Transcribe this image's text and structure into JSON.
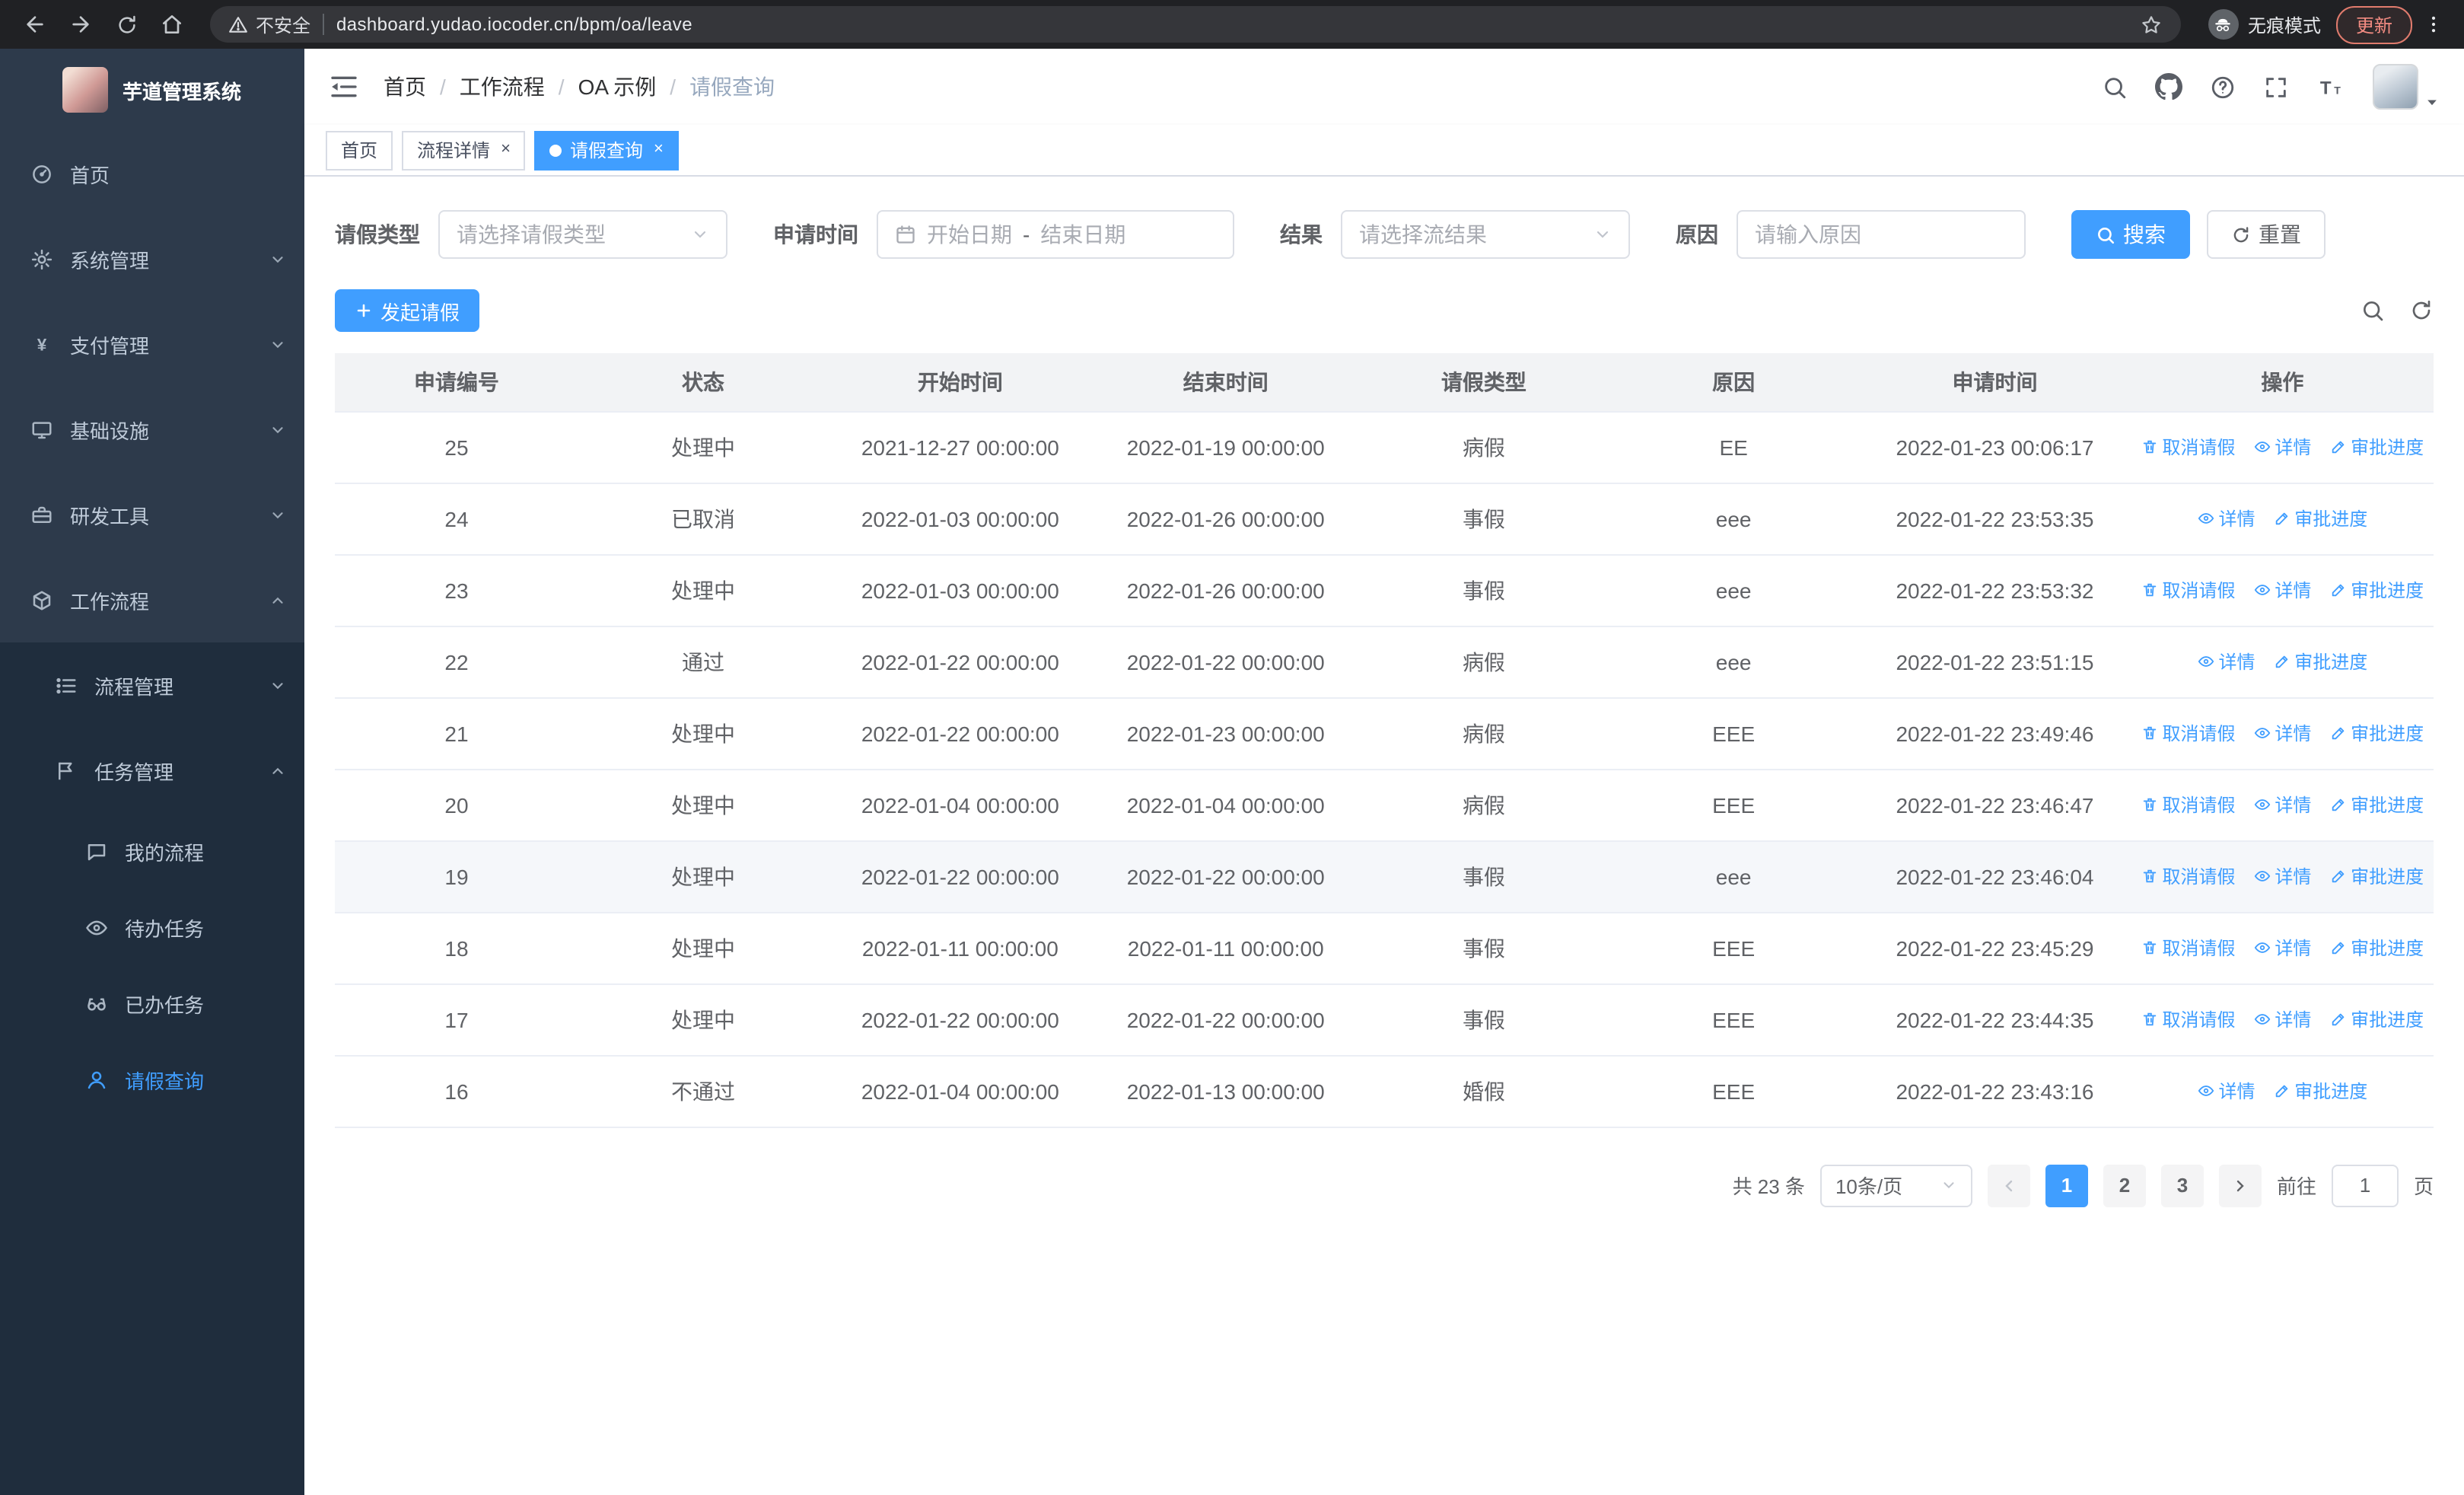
{
  "icons": {
    "close": "×"
  },
  "browser": {
    "security_label": "不安全",
    "url": "dashboard.yudao.iocoder.cn/bpm/oa/leave",
    "incognito_label": "无痕模式",
    "update_label": "更新"
  },
  "sidebar": {
    "title": "芋道管理系统",
    "items": [
      {
        "label": "首页",
        "icon": "dashboard"
      },
      {
        "label": "系统管理",
        "icon": "gear"
      },
      {
        "label": "支付管理",
        "icon": "yen"
      },
      {
        "label": "基础设施",
        "icon": "monitor"
      },
      {
        "label": "研发工具",
        "icon": "toolbox"
      },
      {
        "label": "工作流程",
        "icon": "workflow",
        "expanded": true
      }
    ],
    "submenu": [
      {
        "label": "流程管理",
        "icon": "list"
      },
      {
        "label": "任务管理",
        "icon": "flag",
        "expanded": true
      }
    ],
    "task_children": [
      {
        "label": "我的流程",
        "icon": "chat"
      },
      {
        "label": "待办任务",
        "icon": "eye"
      },
      {
        "label": "已办任务",
        "icon": "glasses"
      },
      {
        "label": "请假查询",
        "icon": "user",
        "active": true
      }
    ]
  },
  "header": {
    "breadcrumb": [
      "首页",
      "工作流程",
      "OA 示例",
      "请假查询"
    ],
    "breadcrumb_separator": "/"
  },
  "tabs": [
    {
      "label": "首页"
    },
    {
      "label": "流程详情",
      "closable": true
    },
    {
      "label": "请假查询",
      "closable": true,
      "active": true
    }
  ],
  "filters": {
    "leave_type_label": "请假类型",
    "leave_type_placeholder": "请选择请假类型",
    "apply_time_label": "申请时间",
    "start_date_placeholder": "开始日期",
    "range_separator": "-",
    "end_date_placeholder": "结束日期",
    "result_label": "结果",
    "result_placeholder": "请选择流结果",
    "reason_label": "原因",
    "reason_placeholder": "请输入原因",
    "search_label": "搜索",
    "reset_label": "重置"
  },
  "toolbar": {
    "create_label": "发起请假"
  },
  "table": {
    "columns": [
      "申请编号",
      "状态",
      "开始时间",
      "结束时间",
      "请假类型",
      "原因",
      "申请时间",
      "操作"
    ],
    "action_labels": {
      "cancel": "取消请假",
      "detail": "详情",
      "progress": "审批进度"
    },
    "rows": [
      {
        "id": "25",
        "status": "处理中",
        "start_time": "2021-12-27 00:00:00",
        "end_time": "2022-01-19 00:00:00",
        "leave_type": "病假",
        "reason": "EE",
        "apply_time": "2022-01-23 00:06:17",
        "can_cancel": true
      },
      {
        "id": "24",
        "status": "已取消",
        "start_time": "2022-01-03 00:00:00",
        "end_time": "2022-01-26 00:00:00",
        "leave_type": "事假",
        "reason": "eee",
        "apply_time": "2022-01-22 23:53:35",
        "can_cancel": false
      },
      {
        "id": "23",
        "status": "处理中",
        "start_time": "2022-01-03 00:00:00",
        "end_time": "2022-01-26 00:00:00",
        "leave_type": "事假",
        "reason": "eee",
        "apply_time": "2022-01-22 23:53:32",
        "can_cancel": true
      },
      {
        "id": "22",
        "status": "通过",
        "start_time": "2022-01-22 00:00:00",
        "end_time": "2022-01-22 00:00:00",
        "leave_type": "病假",
        "reason": "eee",
        "apply_time": "2022-01-22 23:51:15",
        "can_cancel": false
      },
      {
        "id": "21",
        "status": "处理中",
        "start_time": "2022-01-22 00:00:00",
        "end_time": "2022-01-23 00:00:00",
        "leave_type": "病假",
        "reason": "EEE",
        "apply_time": "2022-01-22 23:49:46",
        "can_cancel": true
      },
      {
        "id": "20",
        "status": "处理中",
        "start_time": "2022-01-04 00:00:00",
        "end_time": "2022-01-04 00:00:00",
        "leave_type": "病假",
        "reason": "EEE",
        "apply_time": "2022-01-22 23:46:47",
        "can_cancel": true
      },
      {
        "id": "19",
        "status": "处理中",
        "start_time": "2022-01-22 00:00:00",
        "end_time": "2022-01-22 00:00:00",
        "leave_type": "事假",
        "reason": "eee",
        "apply_time": "2022-01-22 23:46:04",
        "can_cancel": true,
        "highlighted": true
      },
      {
        "id": "18",
        "status": "处理中",
        "start_time": "2022-01-11 00:00:00",
        "end_time": "2022-01-11 00:00:00",
        "leave_type": "事假",
        "reason": "EEE",
        "apply_time": "2022-01-22 23:45:29",
        "can_cancel": true
      },
      {
        "id": "17",
        "status": "处理中",
        "start_time": "2022-01-22 00:00:00",
        "end_time": "2022-01-22 00:00:00",
        "leave_type": "事假",
        "reason": "EEE",
        "apply_time": "2022-01-22 23:44:35",
        "can_cancel": true
      },
      {
        "id": "16",
        "status": "不通过",
        "start_time": "2022-01-04 00:00:00",
        "end_time": "2022-01-13 00:00:00",
        "leave_type": "婚假",
        "reason": "EEE",
        "apply_time": "2022-01-22 23:43:16",
        "can_cancel": false
      }
    ]
  },
  "pagination": {
    "total_label": "共 23 条",
    "page_size_label": "10条/页",
    "pages": [
      "1",
      "2",
      "3"
    ],
    "goto_label": "前往",
    "goto_value": "1",
    "page_unit": "页"
  }
}
